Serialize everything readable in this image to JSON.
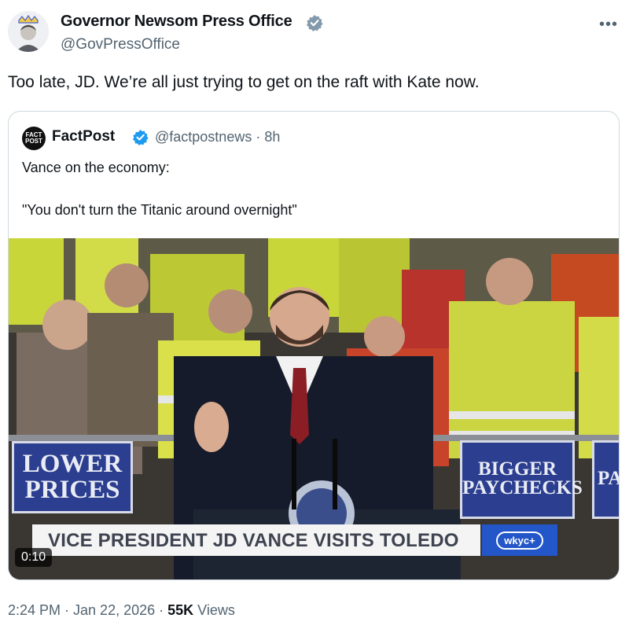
{
  "author": {
    "display_name": "Governor Newsom Press Office",
    "handle": "@GovPressOffice",
    "verified_color": "#536471"
  },
  "post": {
    "text": "Too late, JD. We’re all just trying to get on the raft with Kate now."
  },
  "quoted": {
    "avatar_text_1": "FACT",
    "avatar_text_2": "POST",
    "name": "FactPost",
    "verified_color": "#1d9bf0",
    "handle_time": "@factpostnews · 8h",
    "line1": "Vance on the economy:",
    "line2": "\"You don't turn the Titanic around overnight\"",
    "video": {
      "sign_left": "LOWER PRICES",
      "sign_right": "BIGGER PAYCHECKS",
      "sign_far_right": "PA",
      "chyron": "VICE PRESIDENT JD VANCE VISITS TOLEDO",
      "station_logo": "wkyc+",
      "duration": "0:10"
    }
  },
  "meta": {
    "time_date": "2:24 PM · Jan 22, 2026 · ",
    "views_count": "55K",
    "views_label": " Views"
  },
  "icons": {
    "more": "more-icon",
    "verified": "verified-badge-icon"
  }
}
